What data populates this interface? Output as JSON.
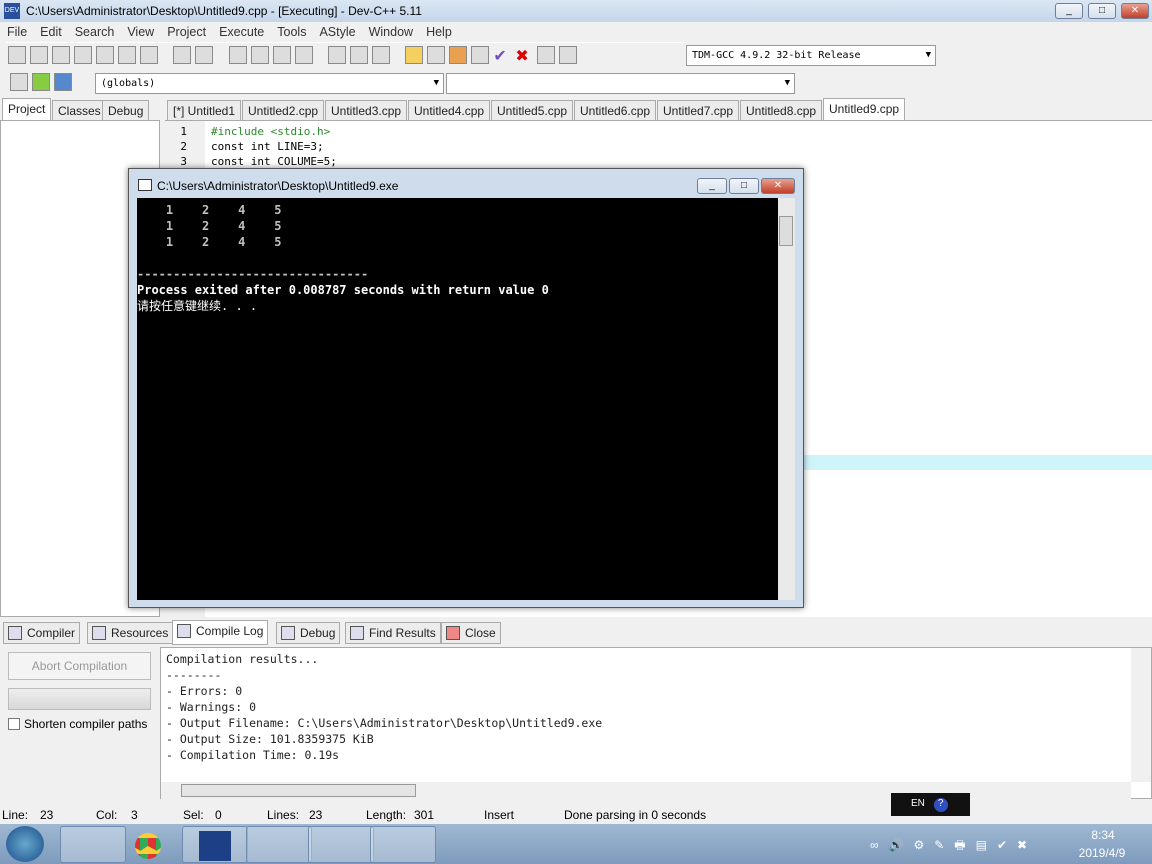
{
  "window": {
    "title": "C:\\Users\\Administrator\\Desktop\\Untitled9.cpp - [Executing] - Dev-C++ 5.11",
    "app_icon": "DEV"
  },
  "menu": [
    "File",
    "Edit",
    "Search",
    "View",
    "Project",
    "Execute",
    "Tools",
    "AStyle",
    "Window",
    "Help"
  ],
  "toolbar": {
    "compiler": "TDM-GCC 4.9.2 32-bit Release",
    "scope": "(globals)",
    "member": ""
  },
  "left_tabs": [
    "Project",
    "Classes",
    "Debug"
  ],
  "file_tabs": [
    "[*] Untitled1",
    "Untitled2.cpp",
    "Untitled3.cpp",
    "Untitled4.cpp",
    "Untitled5.cpp",
    "Untitled6.cpp",
    "Untitled7.cpp",
    "Untitled8.cpp",
    "Untitled9.cpp"
  ],
  "code": [
    {
      "n": "1",
      "text": "#include <stdio.h>"
    },
    {
      "n": "2",
      "text": "const int LINE=3;"
    },
    {
      "n": "3",
      "text": "const int COLUME=5;"
    }
  ],
  "console": {
    "title": "C:\\Users\\Administrator\\Desktop\\Untitled9.exe",
    "lines": [
      "    1    2    4    5",
      "    1    2    4    5",
      "    1    2    4    5",
      "",
      "--------------------------------",
      "Process exited after 0.008787 seconds with return value 0",
      "请按任意键继续. . ."
    ]
  },
  "bottom_tabs": [
    "Compiler",
    "Resources",
    "Compile Log",
    "Debug",
    "Find Results",
    "Close"
  ],
  "compile_panel": {
    "abort": "Abort Compilation",
    "shorten": "Shorten compiler paths",
    "shorten_checked": false,
    "log": [
      "Compilation results...",
      "--------",
      "- Errors: 0",
      "- Warnings: 0",
      "- Output Filename: C:\\Users\\Administrator\\Desktop\\Untitled9.exe",
      "- Output Size: 101.8359375 KiB",
      "- Compilation Time: 0.19s"
    ]
  },
  "status": {
    "line_label": "Line:",
    "line": "23",
    "col_label": "Col:",
    "col": "3",
    "sel_label": "Sel:",
    "sel": "0",
    "lines_label": "Lines:",
    "lines": "23",
    "length_label": "Length:",
    "length": "301",
    "mode": "Insert",
    "message": "Done parsing in 0 seconds"
  },
  "ime": "EN",
  "taskbar": {
    "time": "8:34",
    "date": "2019/4/9",
    "apps": [
      "explorer",
      "chrome",
      "devcpp",
      "dev-cpp-project",
      "paint",
      "notepad-window"
    ]
  }
}
